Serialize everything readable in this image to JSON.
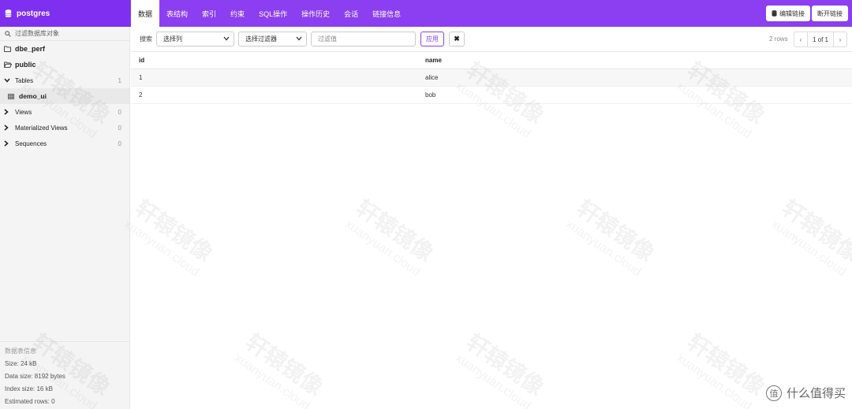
{
  "header": {
    "db_name": "postgres",
    "tabs": [
      "数据",
      "表结构",
      "索引",
      "约束",
      "SQL操作",
      "操作历史",
      "会话",
      "链接信息"
    ],
    "edit_button": "编辑链接",
    "disconnect_button": "断开链接",
    "accent": "#8b3ff0"
  },
  "sidebar": {
    "search_placeholder": "过滤数据库对象",
    "schemas": [
      "dbe_perf",
      "public"
    ],
    "tables_label": "Tables",
    "tables_count": "1",
    "table_item": "demo_ui",
    "views_label": "Views",
    "views_count": "0",
    "mviews_label": "Materialized Views",
    "mviews_count": "0",
    "sequences_label": "Sequences",
    "sequences_count": "0",
    "info": {
      "title": "数据表信息",
      "size": "Size: 24 kB",
      "data_size": "Data size: 8192 bytes",
      "index_size": "Index size: 16 kB",
      "estimated_rows": "Estimated rows: 0"
    }
  },
  "filter": {
    "search_label": "搜索",
    "column_select": "选择列",
    "filter_select": "选择过滤器",
    "value_placeholder": "过滤值",
    "apply_label": "应用",
    "clear_label": "✖",
    "rows_text": "2 rows",
    "page_text": "1 of 1",
    "prev": "‹",
    "next": "›"
  },
  "table": {
    "columns": [
      "id",
      "name"
    ],
    "rows": [
      [
        "1",
        "alice"
      ],
      [
        "2",
        "bob"
      ]
    ]
  },
  "watermark": {
    "text": "轩辕镜像",
    "sub": "xuanyuan.cloud",
    "brand": "什么值得买",
    "brand_logo": "值"
  }
}
